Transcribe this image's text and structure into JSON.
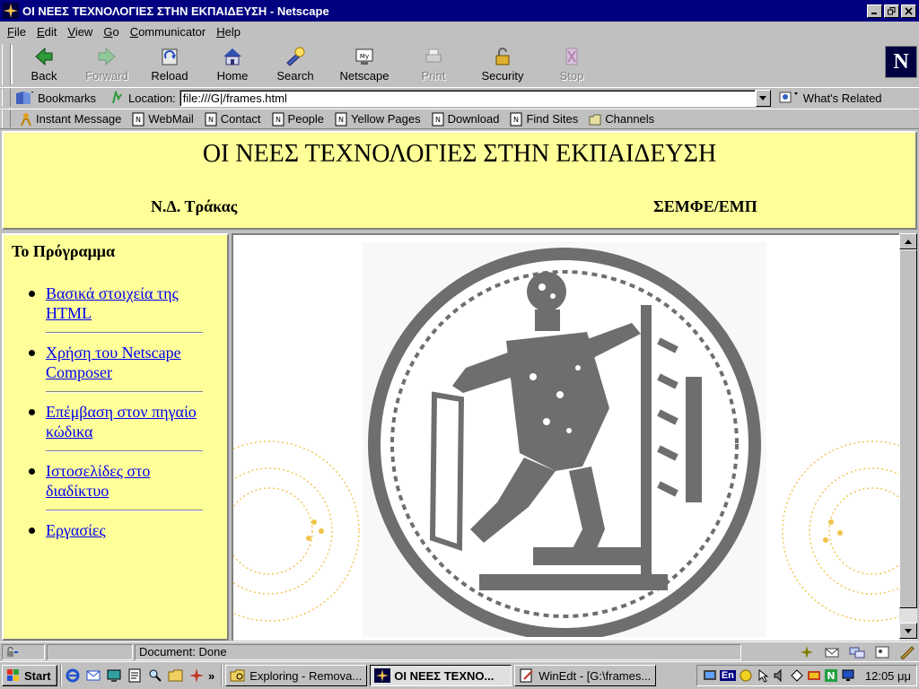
{
  "window": {
    "title": "ΟΙ ΝΕΕΣ ΤΕΧΝΟΛΟΓΙΕΣ ΣΤΗΝ ΕΚΠΑΙΔΕΥΣΗ - Netscape"
  },
  "menu": [
    {
      "underline": "F",
      "rest": "ile"
    },
    {
      "underline": "E",
      "rest": "dit"
    },
    {
      "underline": "V",
      "rest": "iew"
    },
    {
      "underline": "G",
      "rest": "o"
    },
    {
      "underline": "C",
      "rest": "ommunicator"
    },
    {
      "underline": "H",
      "rest": "elp"
    }
  ],
  "toolbar": {
    "back": "Back",
    "forward": "Forward",
    "reload": "Reload",
    "home": "Home",
    "search": "Search",
    "netscape": "Netscape",
    "print": "Print",
    "security": "Security",
    "stop": "Stop",
    "logo": "N"
  },
  "location_bar": {
    "bookmarks": "Bookmarks",
    "location_label": "Location:",
    "url": "file:///G|/frames.html",
    "related": "What's Related"
  },
  "personal_toolbar": [
    "Instant Message",
    "WebMail",
    "Contact",
    "People",
    "Yellow Pages",
    "Download",
    "Find Sites",
    "Channels"
  ],
  "page": {
    "title": "ΟΙ ΝΕΕΣ ΤΕΧΝΟΛΟΓΙΕΣ ΣΤΗΝ ΕΚΠΑΙΔΕΥΣΗ",
    "author": "Ν.Δ. Τράκας",
    "department": "ΣΕΜΦΕ/ΕΜΠ",
    "nav_heading": "Το Πρόγραμμα",
    "nav_links": [
      "Βασικά στοιχεία της HTML",
      "Χρήση του Netscape Composer",
      "Επέμβαση στον πηγαίο κώδικα",
      "Ιστοσελίδες στο διαδίκτυο",
      "Εργασίες"
    ]
  },
  "status": {
    "text": "Document: Done"
  },
  "taskbar": {
    "start": "Start",
    "more": "»",
    "tasks": [
      "Exploring - Remova...",
      "ΟΙ ΝΕΕΣ ΤΕΧΝΟ...",
      "WinEdt - [G:\\frames..."
    ],
    "language": "En",
    "clock": "12:05 μμ"
  },
  "colors": {
    "titlebar": "#000080",
    "frame_background": "#ffff99",
    "link": "#0000ee",
    "seal": "#6e6e6e",
    "ornament": "#f2c34a"
  }
}
